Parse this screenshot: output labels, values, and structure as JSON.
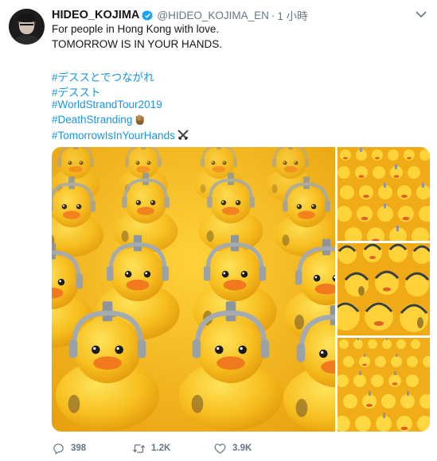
{
  "user": {
    "name": "HIDEO_KOJIMA",
    "handle": "@HIDEO_KOJIMA_EN",
    "separator": "·",
    "time": "1 小時"
  },
  "text": {
    "line1": "For people in Hong Kong with love.",
    "line2": "TOMORROW IS IN YOUR HANDS."
  },
  "hashtags": [
    "#デススとでつながれ",
    "#デススト",
    "#WorldStrandTour2019",
    "#DeathStranding",
    "#TomorrowIsInYourHands"
  ],
  "stats": {
    "replies": "398",
    "retweets": "1.2K",
    "likes": "3.9K"
  },
  "colors": {
    "link": "#1b95e0",
    "muted": "#657786",
    "verified": "#1da1f2",
    "duck_yellow": "#f3b11a"
  },
  "icons": [
    "verified-badge-icon",
    "chevron-down-icon",
    "reply-icon",
    "retweet-icon",
    "like-icon",
    "hand-emoji-icon",
    "crossed-swords-emoji-icon"
  ]
}
